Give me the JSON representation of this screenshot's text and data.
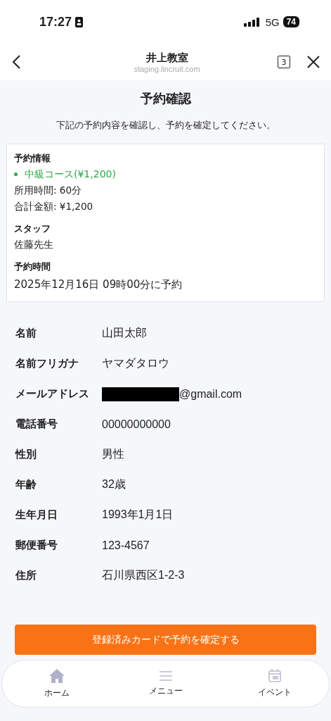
{
  "status_bar": {
    "time": "17:27",
    "network": "5G",
    "battery": "74"
  },
  "header": {
    "title": "井上教室",
    "url": "staging.lincruit.com",
    "tab_count": "3"
  },
  "page": {
    "title": "予約確認",
    "subtitle": "下記の予約内容を確認し、予約を確定してください。"
  },
  "summary": {
    "sections": [
      {
        "heading": "予約情報",
        "course": "中級コース(¥1,200)",
        "lines": [
          "所用時間: 60分",
          "合計金額: ¥1,200"
        ],
        "large": false
      },
      {
        "heading": "スタッフ",
        "lines": [
          "佐藤先生"
        ],
        "large": false
      },
      {
        "heading": "予約時間",
        "lines": [
          "2025年12月16日 09時00分に予約"
        ],
        "large": true
      }
    ]
  },
  "fields": [
    {
      "label": "名前",
      "value": "山田太郎",
      "redacted": false
    },
    {
      "label": "名前フリガナ",
      "value": "ヤマダタロウ",
      "redacted": false
    },
    {
      "label": "メールアドレス",
      "value": "@gmail.com",
      "redacted": true
    },
    {
      "label": "電話番号",
      "value": "00000000000",
      "redacted": false
    },
    {
      "label": "性別",
      "value": "男性",
      "redacted": false
    },
    {
      "label": "年齢",
      "value": "32歳",
      "redacted": false
    },
    {
      "label": "生年月日",
      "value": "1993年1月1日",
      "redacted": false
    },
    {
      "label": "郵便番号",
      "value": "123-4567",
      "redacted": false
    },
    {
      "label": "住所",
      "value": "石川県西区1-2-3",
      "redacted": false
    }
  ],
  "confirm_button": "登録済みカードで予約を確定する",
  "bottom_nav": [
    {
      "kind": "home",
      "label": "ホーム"
    },
    {
      "kind": "menu",
      "label": "メニュー"
    },
    {
      "kind": "calendar",
      "label": "イベント"
    }
  ]
}
